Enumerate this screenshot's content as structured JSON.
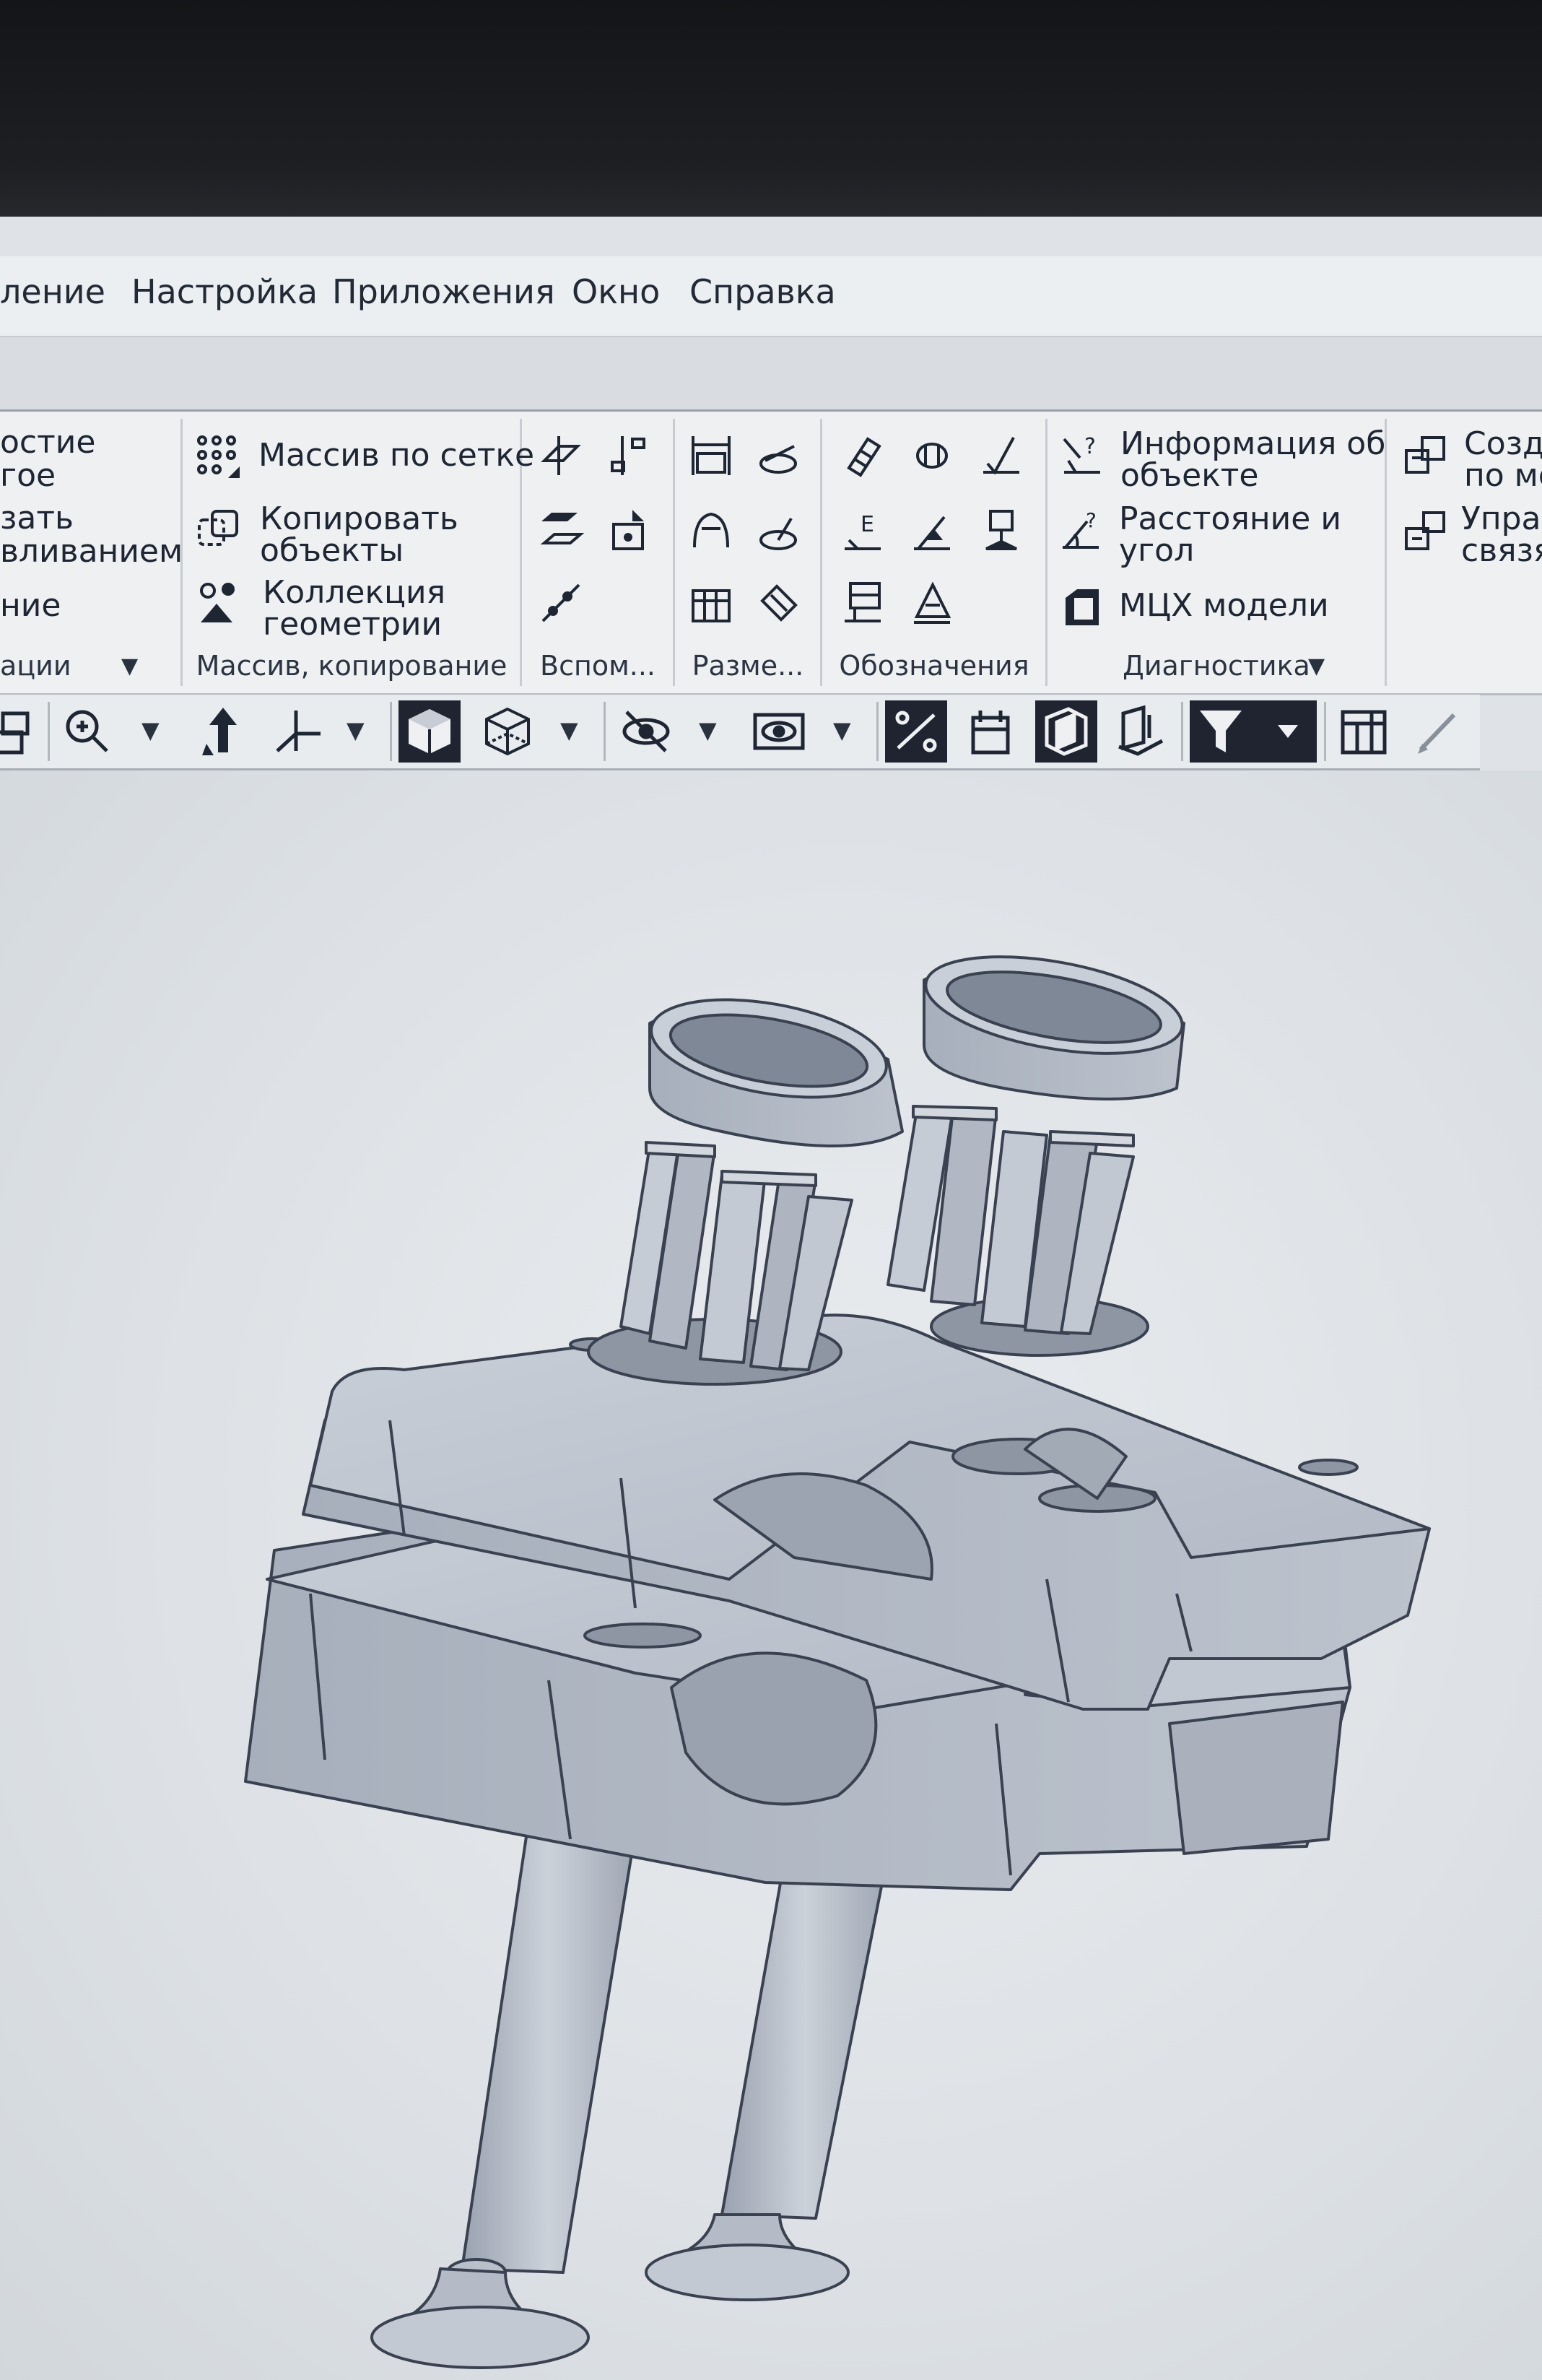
{
  "menu": {
    "items": [
      "ление",
      "Настройка",
      "Приложения",
      "Окно",
      "Справка"
    ]
  },
  "ribbon": {
    "group1": {
      "lines": [
        "остие",
        "гое",
        "зать",
        "вливанием",
        "ние"
      ],
      "title": "ации"
    },
    "group2": {
      "btn1": "Массив по сетке",
      "btn2_l1": "Копировать",
      "btn2_l2": "объекты",
      "btn3_l1": "Коллекция",
      "btn3_l2": "геометрии",
      "title": "Массив, копирование"
    },
    "group3": {
      "title": "Вспом..."
    },
    "group4": {
      "title": "Разме..."
    },
    "group5": {
      "title": "Обозначения"
    },
    "group6": {
      "btn1_l1": "Информация об",
      "btn1_l2": "объекте",
      "btn2_l1": "Расстояние и",
      "btn2_l2": "угол",
      "btn3": "МЦХ модели",
      "title": "Диагностика"
    },
    "group7": {
      "btn1_l1": "Созда",
      "btn1_l2": "по мо",
      "btn2_l1": "Управ",
      "btn2_l2": "связя"
    }
  },
  "toolbar": {
    "icons": [
      "layers-icon",
      "zoom-icon",
      "orient-icon",
      "axes-icon",
      "shaded-cube-icon",
      "wireframe-cube-icon",
      "hidden-lines-icon",
      "visibility-icon",
      "constraints-icon",
      "calendar-icon",
      "perspective-icon",
      "section-icon",
      "filter-icon",
      "table-icon",
      "pencil-icon"
    ]
  },
  "colors": {
    "menubar_bg": "#eceff2",
    "ribbon_bg": "#eef0f2",
    "viewport_bg": "#e2e6ea",
    "model_fill": "#b6bdc8",
    "model_edge": "#3a4150"
  }
}
